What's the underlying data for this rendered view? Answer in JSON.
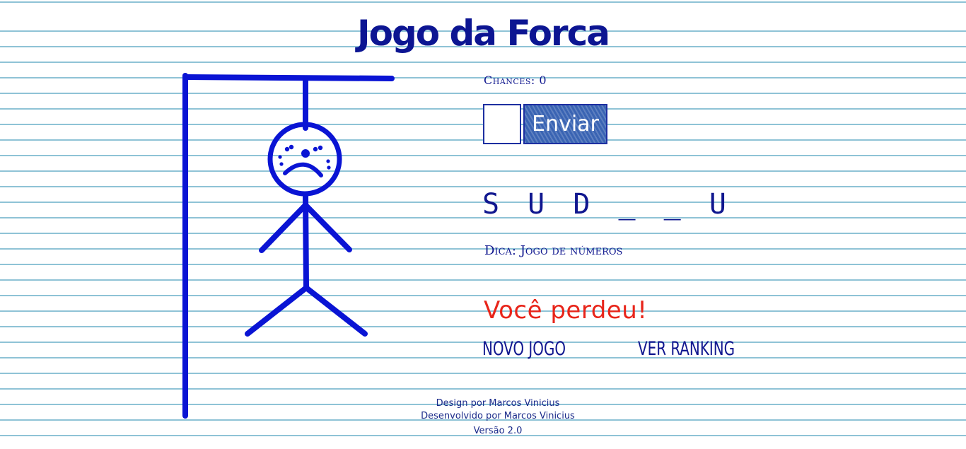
{
  "header": {
    "title": "Jogo da Forca"
  },
  "game": {
    "chances_label": "Chances: 0",
    "letter_input_value": "",
    "send_label": "Enviar",
    "word": "S U D _ _ U",
    "hint": "Dica: Jogo de números",
    "result": "Você perdeu!",
    "new_game_label": "NOVO JOGO",
    "ranking_label": "VER RANKING"
  },
  "hangman": {
    "parts_drawn": [
      "head",
      "body",
      "left-arm",
      "right-arm",
      "left-leg",
      "right-leg"
    ],
    "face": "sad"
  },
  "footer": {
    "design_credit": "Design por Marcos Vinicius",
    "dev_credit": "Desenvolvido por Marcos Vinicius",
    "version": "Versão 2.0"
  },
  "colors": {
    "ink": "#10178f",
    "drawing": "#0a14d4",
    "lose": "#e8251a",
    "button": "#3a64b3",
    "rule_lines": "#8fc3d6"
  }
}
